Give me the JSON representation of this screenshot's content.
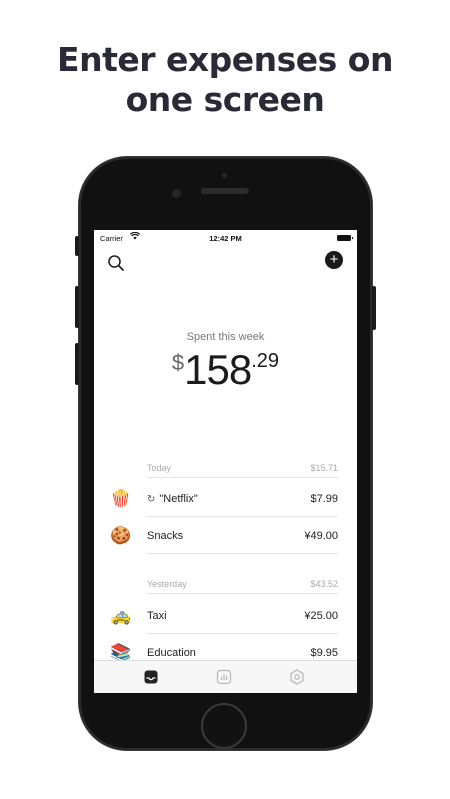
{
  "promo": {
    "line1": "Enter expenses on",
    "line2": "one screen"
  },
  "status_bar": {
    "carrier": "Carrier",
    "time": "12:42 PM"
  },
  "summary": {
    "label": "Spent this week",
    "currency": "$",
    "whole": "158",
    "decimal": ".29"
  },
  "sections": [
    {
      "label": "Today",
      "total": "$15.71",
      "items": [
        {
          "emoji": "🍿",
          "name": "\"Netflix\"",
          "amount": "$7.99",
          "recurring": true
        },
        {
          "emoji": "🍪",
          "name": "Snacks",
          "amount": "¥49.00"
        }
      ]
    },
    {
      "label": "Yesterday",
      "total": "$43.52",
      "items": [
        {
          "emoji": "🚕",
          "name": "Taxi",
          "amount": "¥25.00"
        },
        {
          "emoji": "📚",
          "name": "Education",
          "amount": "$9.95"
        }
      ]
    }
  ],
  "tabs": [
    {
      "icon": "inbox-icon",
      "active": true
    },
    {
      "icon": "bar-chart-icon",
      "active": false
    },
    {
      "icon": "settings-icon",
      "active": false
    }
  ],
  "colors": {
    "headline": "#2a2a36",
    "phone_body": "#111111",
    "tab_active": "#222222",
    "tab_inactive": "#b5b5b5"
  }
}
